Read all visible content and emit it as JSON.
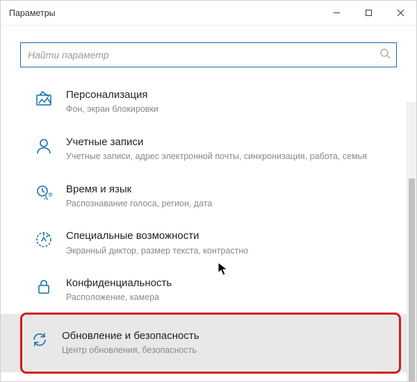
{
  "window": {
    "title": "Параметры"
  },
  "search": {
    "placeholder": "Найти параметр"
  },
  "items": [
    {
      "icon": "personalization",
      "title": "Персонализация",
      "sub": "Фон, экран блокировки"
    },
    {
      "icon": "accounts",
      "title": "Учетные записи",
      "sub": "Учетные записи, адрес электронной почты, синхронизация, работа, семья"
    },
    {
      "icon": "time-language",
      "title": "Время и язык",
      "sub": "Распознавание голоса, регион, дата"
    },
    {
      "icon": "ease-of-access",
      "title": "Специальные возможности",
      "sub": "Экранный диктор, размер текста, контрастно"
    },
    {
      "icon": "privacy",
      "title": "Конфиденциальность",
      "sub": "Расположение, камера"
    },
    {
      "icon": "update-security",
      "title": "Обновление и безопасность",
      "sub": "Центр обновления, безопасность"
    }
  ]
}
